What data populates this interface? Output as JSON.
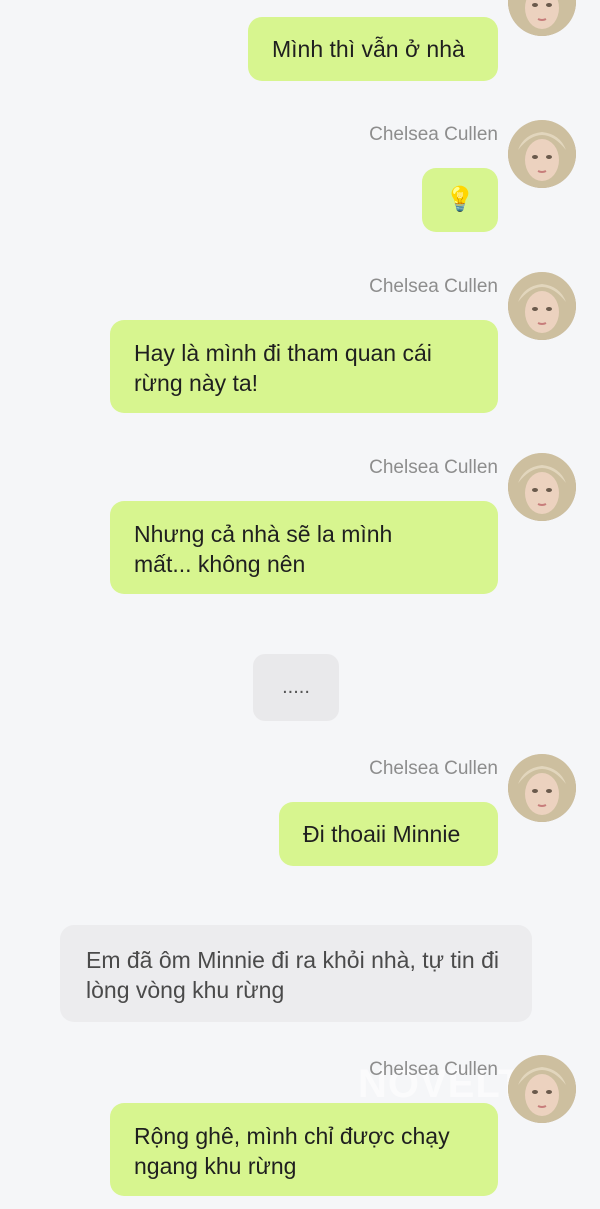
{
  "character": {
    "name": "Chelsea Cullen",
    "avatar": "blonde-woman-avatar"
  },
  "messages": [
    {
      "type": "character",
      "text": "Mình thì vẫn ở nhà",
      "show_name": false
    },
    {
      "type": "character",
      "text": "💡",
      "show_name": true
    },
    {
      "type": "character",
      "text": "Hay là mình đi tham quan cái rừng này ta!",
      "show_name": true
    },
    {
      "type": "character",
      "text": "Nhưng cả nhà sẽ la mình mất... không nên",
      "show_name": true
    },
    {
      "type": "ellipsis",
      "text": "....."
    },
    {
      "type": "character",
      "text": "Đi thoaii Minnie",
      "show_name": true
    },
    {
      "type": "narration",
      "text": "Em đã ôm Minnie đi ra khỏi nhà, tự tin đi lòng vòng khu rừng"
    },
    {
      "type": "character",
      "text": "Rộng ghê, mình chỉ được chạy ngang khu rừng",
      "show_name": true
    }
  ],
  "watermark": "NOVELTO",
  "colors": {
    "bubble": "#d7f58f",
    "narration": "#ececee",
    "background": "#f5f6f8",
    "name": "#8d8d8d"
  }
}
